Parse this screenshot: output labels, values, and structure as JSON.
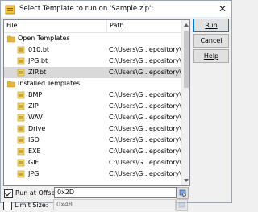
{
  "dialog": {
    "title": "Select Template to run on 'Sample.zip':",
    "close_label": "✕"
  },
  "list": {
    "columns": {
      "file": "File",
      "path": "Path"
    },
    "rows": [
      {
        "type": "folder",
        "name": "Open Templates",
        "path": ""
      },
      {
        "type": "item",
        "name": "010.bt",
        "path": "C:\\Users\\G...epository\\"
      },
      {
        "type": "item",
        "name": "JPG.bt",
        "path": "C:\\Users\\G...epository\\"
      },
      {
        "type": "item",
        "name": "ZIP.bt",
        "path": "C:\\Users\\G...epository\\",
        "selected": true
      },
      {
        "type": "folder",
        "name": "Installed Templates",
        "path": ""
      },
      {
        "type": "item",
        "name": "BMP",
        "path": "C:\\Users\\G...epository\\"
      },
      {
        "type": "item",
        "name": "ZIP",
        "path": "C:\\Users\\G...epository\\"
      },
      {
        "type": "item",
        "name": "WAV",
        "path": "C:\\Users\\G...epository\\"
      },
      {
        "type": "item",
        "name": "Drive",
        "path": "C:\\Users\\G...epository\\"
      },
      {
        "type": "item",
        "name": "ISO",
        "path": "C:\\Users\\G...epository\\"
      },
      {
        "type": "item",
        "name": "EXE",
        "path": "C:\\Users\\G...epository\\"
      },
      {
        "type": "item",
        "name": "GIF",
        "path": "C:\\Users\\G...epository\\"
      },
      {
        "type": "item",
        "name": "JPG",
        "path": "C:\\Users\\G...epository\\"
      }
    ]
  },
  "buttons": {
    "run": "Run",
    "cancel": "Cancel",
    "help": "Help"
  },
  "options": {
    "run_at_offset": {
      "label": "Run at Offset:",
      "checked": true,
      "value": "0x2D"
    },
    "limit_size": {
      "label": "Limit Size:",
      "checked": false,
      "value": "0x48"
    }
  },
  "colors": {
    "selected_row": "#d9d9d9",
    "default_button_border": "#0078d7",
    "folder": "#e8b73a"
  }
}
